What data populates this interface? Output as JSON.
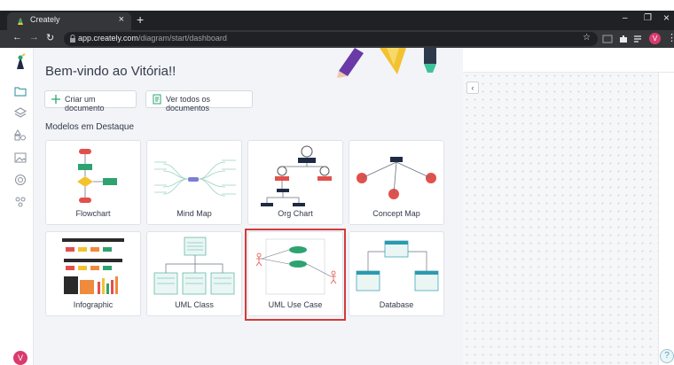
{
  "browser": {
    "tab_title": "Creately",
    "tab_close": "×",
    "new_tab": "+",
    "url_host": "app.creately.com",
    "url_path": "/diagram/start/dashboard",
    "profile_initial": "V",
    "minimize": "–",
    "restore": "❐",
    "close": "×"
  },
  "app": {
    "welcome": "Bem-vindo ao Vitória!!",
    "create_button": "Criar um documento",
    "view_all_button": "Ver todos os documentos",
    "section_title": "Modelos em Destaque",
    "user_initial": "V",
    "help": "?",
    "collapse": "‹"
  },
  "templates": [
    {
      "label": "Flowchart"
    },
    {
      "label": "Mind Map"
    },
    {
      "label": "Org Chart"
    },
    {
      "label": "Concept Map"
    },
    {
      "label": "Infographic"
    },
    {
      "label": "UML Class"
    },
    {
      "label": "UML Use Case",
      "highlighted": true
    },
    {
      "label": "Database"
    }
  ],
  "colors": {
    "accent": "#d93b6d",
    "highlight": "#d43a3a",
    "teal": "#2ea36f"
  }
}
